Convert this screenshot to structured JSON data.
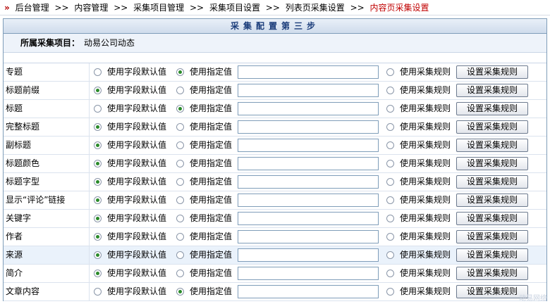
{
  "breadcrumb": {
    "items": [
      "后台管理",
      "内容管理",
      "采集项目管理",
      "采集项目设置",
      "列表页采集设置"
    ],
    "current": "内容页采集设置"
  },
  "panel": {
    "title": "采集配置第三步",
    "project_label": "所属采集项目：",
    "project_value": "动易公司动态"
  },
  "options": {
    "default": "使用字段默认值",
    "specified": "使用指定值",
    "rule": "使用采集规则",
    "rule_button": "设置采集规则"
  },
  "fields": [
    {
      "name": "专题",
      "selected": "specified",
      "value": ""
    },
    {
      "name": "标题前缀",
      "selected": "default",
      "value": ""
    },
    {
      "name": "标题",
      "selected": "specified",
      "value": ""
    },
    {
      "name": "完整标题",
      "selected": "default",
      "value": ""
    },
    {
      "name": "副标题",
      "selected": "default",
      "value": ""
    },
    {
      "name": "标题颜色",
      "selected": "default",
      "value": ""
    },
    {
      "name": "标题字型",
      "selected": "default",
      "value": ""
    },
    {
      "name": "显示“评论”链接",
      "selected": "default",
      "value": ""
    },
    {
      "name": "关键字",
      "selected": "default",
      "value": ""
    },
    {
      "name": "作者",
      "selected": "default",
      "value": ""
    },
    {
      "name": "来源",
      "selected": "default",
      "value": ""
    },
    {
      "name": "简介",
      "selected": "default",
      "value": ""
    },
    {
      "name": "文章内容",
      "selected": "specified",
      "value": ""
    }
  ],
  "highlighted_row": 10,
  "colors": {
    "selected_radio": "#2a8a2a",
    "current_crumb": "#c00000",
    "panel_border": "#7f9db9"
  },
  "watermark": "动易网络"
}
